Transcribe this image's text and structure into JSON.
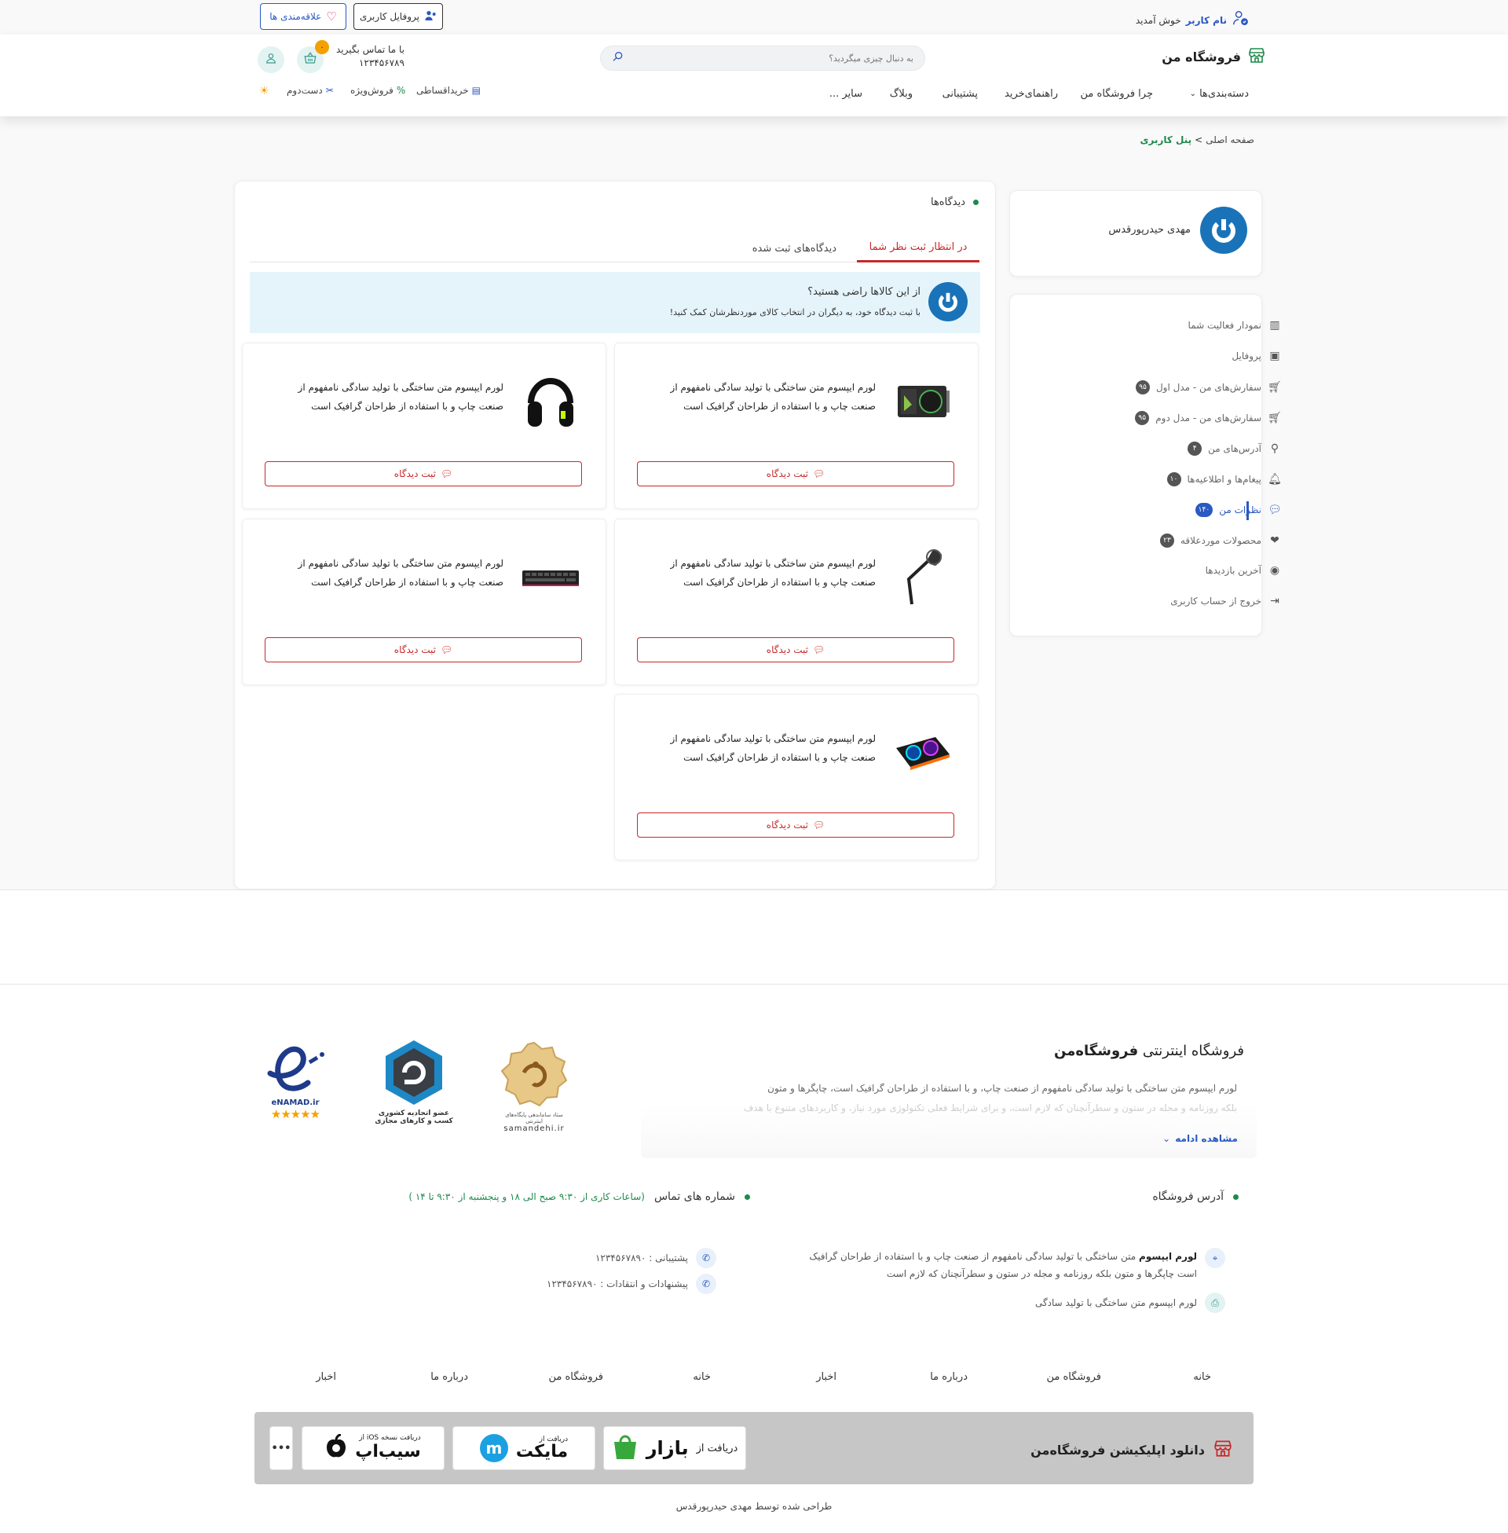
{
  "topbar": {
    "welcome_user": "نام کاربر",
    "welcome_text": "خوش آمدید",
    "wishlist_button": "علاقه‌مندی ها",
    "profile_button": "پروفایل کاربری"
  },
  "header": {
    "store_name": "فروشگاه من",
    "search_placeholder": "به دنبال چیزی میگردید؟",
    "contact_label": "با ما تماس بگیرید",
    "contact_phone": "۱۲۳۴۵۶۷۸۹",
    "cart_count": "۰",
    "nav": [
      "دسته‌بندی‌ها",
      "چرا فروشگاه من",
      "راهنمای‌خرید",
      "پشتیبانی",
      "وبلاگ",
      "سایر ..."
    ],
    "aux": [
      "خریداقساطی",
      "فروش‌ویژه",
      "دست‌دوم"
    ]
  },
  "breadcrumb": {
    "home": "صفحه اصلی",
    "separator": ">",
    "current": "پنل کاربری"
  },
  "sidebar": {
    "user_name": "مهدی حیدرپورقدس",
    "items": [
      {
        "label": "نمودار فعالیت شما",
        "badge": "",
        "icon": "chart-icon"
      },
      {
        "label": "پروفایل",
        "badge": "",
        "icon": "profile-icon"
      },
      {
        "label": "سفارش‌های من - مدل اول",
        "badge": "۹۵",
        "icon": "cart-icon"
      },
      {
        "label": "سفارش‌های من - مدل دوم",
        "badge": "۹۵",
        "icon": "cart-icon"
      },
      {
        "label": "آدرس‌های من",
        "badge": "۴",
        "icon": "user-location-icon"
      },
      {
        "label": "پیغام‌ها و اطلاعیه‌ها",
        "badge": "۱۰",
        "icon": "bell-icon"
      },
      {
        "label": "نظرات من",
        "badge": "۱۴۰",
        "icon": "comment-icon"
      },
      {
        "label": "محصولات موردعلاقه",
        "badge": "۲۳",
        "icon": "heart-icon"
      },
      {
        "label": "آخرین بازدیدها",
        "badge": "",
        "icon": "eye-icon"
      },
      {
        "label": "خروج از حساب کاربری",
        "badge": "",
        "icon": "logout-icon"
      }
    ]
  },
  "main": {
    "title": "دیدگاه‌ها",
    "tabs": [
      "در انتظار ثبت نظر شما",
      "دیدگاه‌های ثبت شده"
    ],
    "banner_title": "از این کالاها راضی هستید؟",
    "banner_text": "با ثبت دیدگاه خود، به دیگران در انتخاب کالای موردنظرشان کمک کنید!",
    "review_button": "ثبت دیدگاه",
    "product_desc_line1": "لورم ایپسوم متن ساختگی با تولید سادگی نامفهوم از",
    "product_desc_line2": "صنعت چاپ و با استفاده از طراحان گرافیک است",
    "products": [
      {
        "image": "graphics-card"
      },
      {
        "image": "headphones"
      },
      {
        "image": "microphone-arm"
      },
      {
        "image": "keyboard"
      },
      {
        "image": "laptop-cooler"
      }
    ]
  },
  "footer": {
    "about_title_normal": "فروشگاه اینترنتی",
    "about_title_bold": "فروشگاه‌من",
    "about_line1": "لورم ایپسوم متن ساختگی با تولید سادگی نامفهوم از صنعت چاپ، و با استفاده از طراحان گرافیک است، چاپگرها و متون",
    "about_line2": "بلکه روزنامه و مجله در ستون و سطرآنچنان که لازم است، و برای شرایط فعلی تکنولوژی مورد نیاز، و کاربردهای متنوع با هدف",
    "see_more": "مشاهده ادامه",
    "badge_samandehi": "samandehi.ir",
    "badge_samandehi_sub": "ستاد ساماندهی پایگاه‌های اینترنتی",
    "badge_etehadiye_1": "عضو اتحادیه کشوری",
    "badge_etehadiye_2": "کسب و کارهای مجازی",
    "badge_enamad": "eNAMAD.ir",
    "address_title": "آدرس فروشگاه",
    "address_bold": "لورم ایپسوم",
    "address_line1": "متن ساختگی با تولید سادگی نامفهوم از صنعت چاپ و با استفاده از طراحان گرافیک",
    "address_line2": "است چاپگرها و متون بلکه روزنامه و مجله در ستون و سطرآنچنان که لازم است",
    "address_line3": "لورم ایپسوم متن ساختگی با تولید سادگی",
    "phones_title": "شماره های تماس",
    "phones_hours": "(ساعات کاری از ۹:۳۰ صبح الی ۱۸ و پنجشنبه از ۹:۳۰ تا ۱۴ )",
    "support_phone": "پشتیبانی : ۱۲۳۴۵۶۷۸۹۰",
    "feedback_phone": "پیشنهادات و انتقادات : ۱۲۳۴۵۶۷۸۹۰",
    "links": [
      "خانه",
      "فروشگاه من",
      "درباره ما",
      "اخبار",
      "خانه",
      "فروشگاه من",
      "درباره ما",
      "اخبار"
    ],
    "app_title": "دانلود اپلیکیشن فروشگاه‌من",
    "bazaar_prefix": "دریافت از",
    "bazaar_name": "بازار",
    "myket_prefix": "دریافت از",
    "myket_name": "مایکت",
    "sibapp_prefix": "دریافت نسخه iOS از",
    "sibapp_name": "سیب‌اپ",
    "more": "•••",
    "credit": "طراحی شده توسط مهدی حیدرپورقدس"
  },
  "colors": {
    "primary_blue": "#2b59c3",
    "accent_red": "#c62828",
    "green": "#1f8a4c",
    "teal_bg": "#e2f3f1",
    "banner_bg": "#e5f4fb"
  }
}
